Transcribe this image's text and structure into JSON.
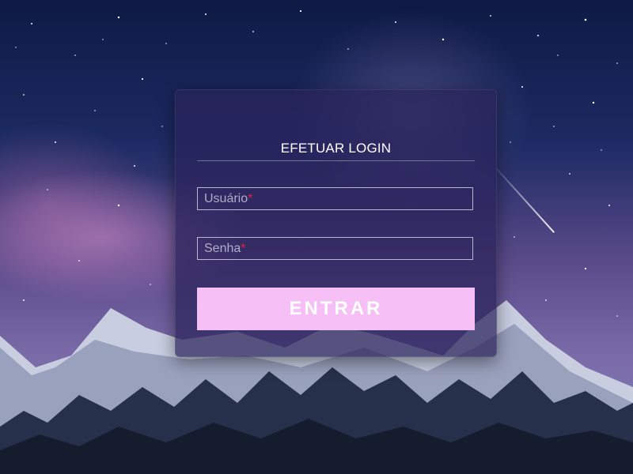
{
  "login": {
    "title": "EFETUAR LOGIN",
    "username_placeholder": "Usuário",
    "password_placeholder": "Senha",
    "required_marker": "*",
    "submit_label": "ENTRAR"
  },
  "colors": {
    "button_bg": "#f6bff6",
    "required_marker": "#e0243c",
    "card_bg": "rgba(42,34,90,0.72)"
  }
}
